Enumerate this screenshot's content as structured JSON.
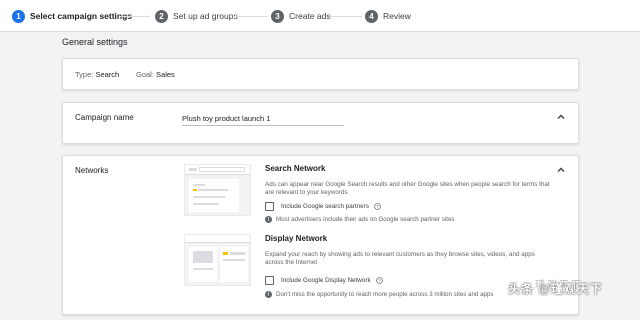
{
  "stepper": {
    "steps": [
      {
        "num": "1",
        "label": "Select campaign settings"
      },
      {
        "num": "2",
        "label": "Set up ad groups"
      },
      {
        "num": "3",
        "label": "Create ads"
      },
      {
        "num": "4",
        "label": "Review"
      }
    ],
    "active_step": 1
  },
  "general": {
    "title": "General settings",
    "type_label": "Type:",
    "type_value": "Search",
    "goal_label": "Goal:",
    "goal_value": "Sales"
  },
  "campaign_name": {
    "label": "Campaign name",
    "value": "Plush toy product launch 1"
  },
  "networks": {
    "label": "Networks",
    "search": {
      "title": "Search Network",
      "description": "Ads can appear near Google Search results and other Google sites when people search for terms that are relevant to your keywords",
      "checkbox_label": "Include Google search partners",
      "checked": false,
      "info": "Most advertisers include their ads on Google search partner sites"
    },
    "display": {
      "title": "Display Network",
      "description": "Expand your reach by showing ads to relevant customers as they browse sites, videos, and apps across the Internet",
      "checkbox_label": "Include Google Display Network",
      "checked": false,
      "info": "Don't miss the opportunity to reach more people across 3 million sites and apps"
    }
  },
  "watermark": {
    "text": "头条 @瑾观天下",
    "faint_text": "瑾观天下"
  },
  "colors": {
    "accent": "#1a73e8",
    "step_inactive": "#5f6368",
    "illustration_highlight": "#fbbc04",
    "background": "#f1f3f4"
  }
}
